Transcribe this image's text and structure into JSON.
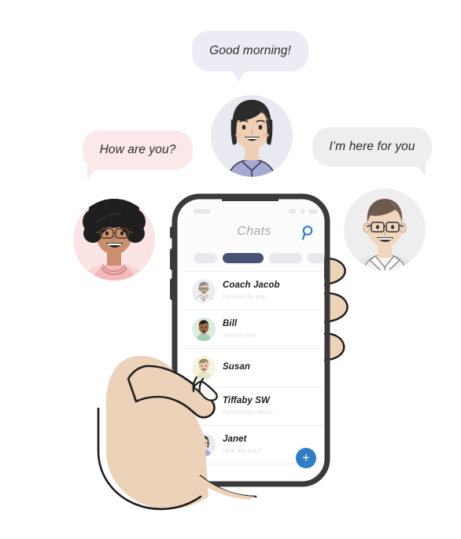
{
  "scene": {
    "title": "Messaging app illustration",
    "background_color": "#ffffff"
  },
  "bubbles": [
    {
      "id": "good-morning",
      "text": "Good morning!",
      "color": "#ecedf4",
      "tail": "bottom-center"
    },
    {
      "id": "how-are-you",
      "text": "How are you?",
      "color": "#fbe9e9",
      "tail": "bottom-left"
    },
    {
      "id": "here-for-you",
      "text": "I’m here for you",
      "color": "#eeeeee",
      "tail": "bottom-right"
    }
  ],
  "avatars": [
    {
      "id": "woman-bob",
      "name": "woman-dark-bob-avatar",
      "circle_color": "#e9eaf1",
      "hair": "#2b2b2b",
      "skin": "#f0d0b4",
      "clothing": "#a6a9d4"
    },
    {
      "id": "woman-curly",
      "name": "woman-curly-glasses-avatar",
      "circle_color": "#fbe4e4",
      "hair": "#1f1f1f",
      "skin": "#c98f6e",
      "clothing": "#f4b9ba"
    },
    {
      "id": "man-glasses",
      "name": "man-glasses-avatar",
      "circle_color": "#eeeeee",
      "hair": "#6e5a4c",
      "skin": "#f0d6bd",
      "clothing": "#e4e4e4"
    }
  ],
  "phone": {
    "frame_color": "#3a3a3a",
    "screen_color": "#fcfcfd",
    "status_bar": {
      "pills": [
        "signal",
        "wifi",
        "battery-dot",
        "battery"
      ]
    },
    "header": {
      "title": "Chats",
      "search_icon": "search-icon",
      "search_color": "#2f7ec4"
    },
    "chips": [
      {
        "label": "",
        "active": false,
        "color": "#e8e9ec"
      },
      {
        "label": "",
        "active": true,
        "color": "#485274"
      },
      {
        "label": "",
        "active": false,
        "color": "#e8e9ec"
      },
      {
        "label": "",
        "active": false,
        "color": "#e8e9ec"
      }
    ],
    "chats": [
      {
        "name": "Coach Jacob",
        "preview": "I'm here for you",
        "avatar_bg": "#edecef",
        "avatar_kind": "man-glasses-suit"
      },
      {
        "name": "Bill",
        "preview": "You`re right",
        "avatar_bg": "#dcece0",
        "avatar_kind": "man-dark-skin"
      },
      {
        "name": "Susan",
        "preview": "",
        "avatar_bg": "#f3f4d9",
        "avatar_kind": "woman-blonde"
      },
      {
        "name": "Tiffaby SW",
        "preview": "Don't forget about...",
        "avatar_bg": "#fadede",
        "avatar_kind": "woman-curly"
      },
      {
        "name": "Janet",
        "preview": "How are you?",
        "avatar_bg": "#e9e9f3",
        "avatar_kind": "woman-bob"
      }
    ],
    "fab": {
      "icon": "plus-icon",
      "color": "#2f7ec4"
    },
    "side_buttons": 3
  },
  "hand": {
    "skin_color": "#ecd2b8",
    "outline_color": "#1d1d1d",
    "description": "left hand holding phone, thumb over screen, three fingertips on right edge"
  }
}
